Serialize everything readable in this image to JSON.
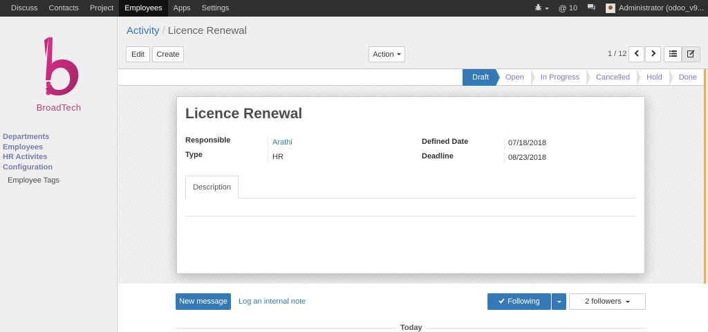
{
  "topbar": {
    "menu": [
      "Discuss",
      "Contacts",
      "Project",
      "Employees",
      "Apps",
      "Settings"
    ],
    "active_menu": "Employees",
    "notification_count": "10",
    "user_name": "Administrator (odoo_v9..."
  },
  "sidebar": {
    "logo_text": "BroadTech",
    "headers": [
      "Departments",
      "Employees",
      "HR Activites",
      "Configuration"
    ],
    "sub_item": "Employee Tags"
  },
  "breadcrumb": {
    "parent": "Activity",
    "separator": "/",
    "current": "Licence Renewal"
  },
  "buttons": {
    "edit": "Edit",
    "create": "Create",
    "action": "Action"
  },
  "pager": {
    "text": "1 / 12"
  },
  "stages": {
    "items": [
      "Draft",
      "Open",
      "In Progress",
      "Cancelled",
      "Hold",
      "Done"
    ],
    "active": "Draft"
  },
  "record": {
    "title": "Licence Renewal",
    "responsible_label": "Responsible",
    "responsible": "Arathi",
    "type_label": "Type",
    "type": "HR",
    "defined_date_label": "Defined Date",
    "defined_date": "07/18/2018",
    "deadline_label": "Deadline",
    "deadline": "08/23/2018",
    "tab_description": "Description"
  },
  "chatter": {
    "new_message": "New message",
    "log_note": "Log an internal note",
    "following": "Following",
    "followers": "2 followers",
    "today": "Today"
  },
  "colors": {
    "primary": "#337ab7",
    "navbar": "#2f2f2f",
    "brand": "#b3407a",
    "accent_line": "#f0ad4e"
  }
}
